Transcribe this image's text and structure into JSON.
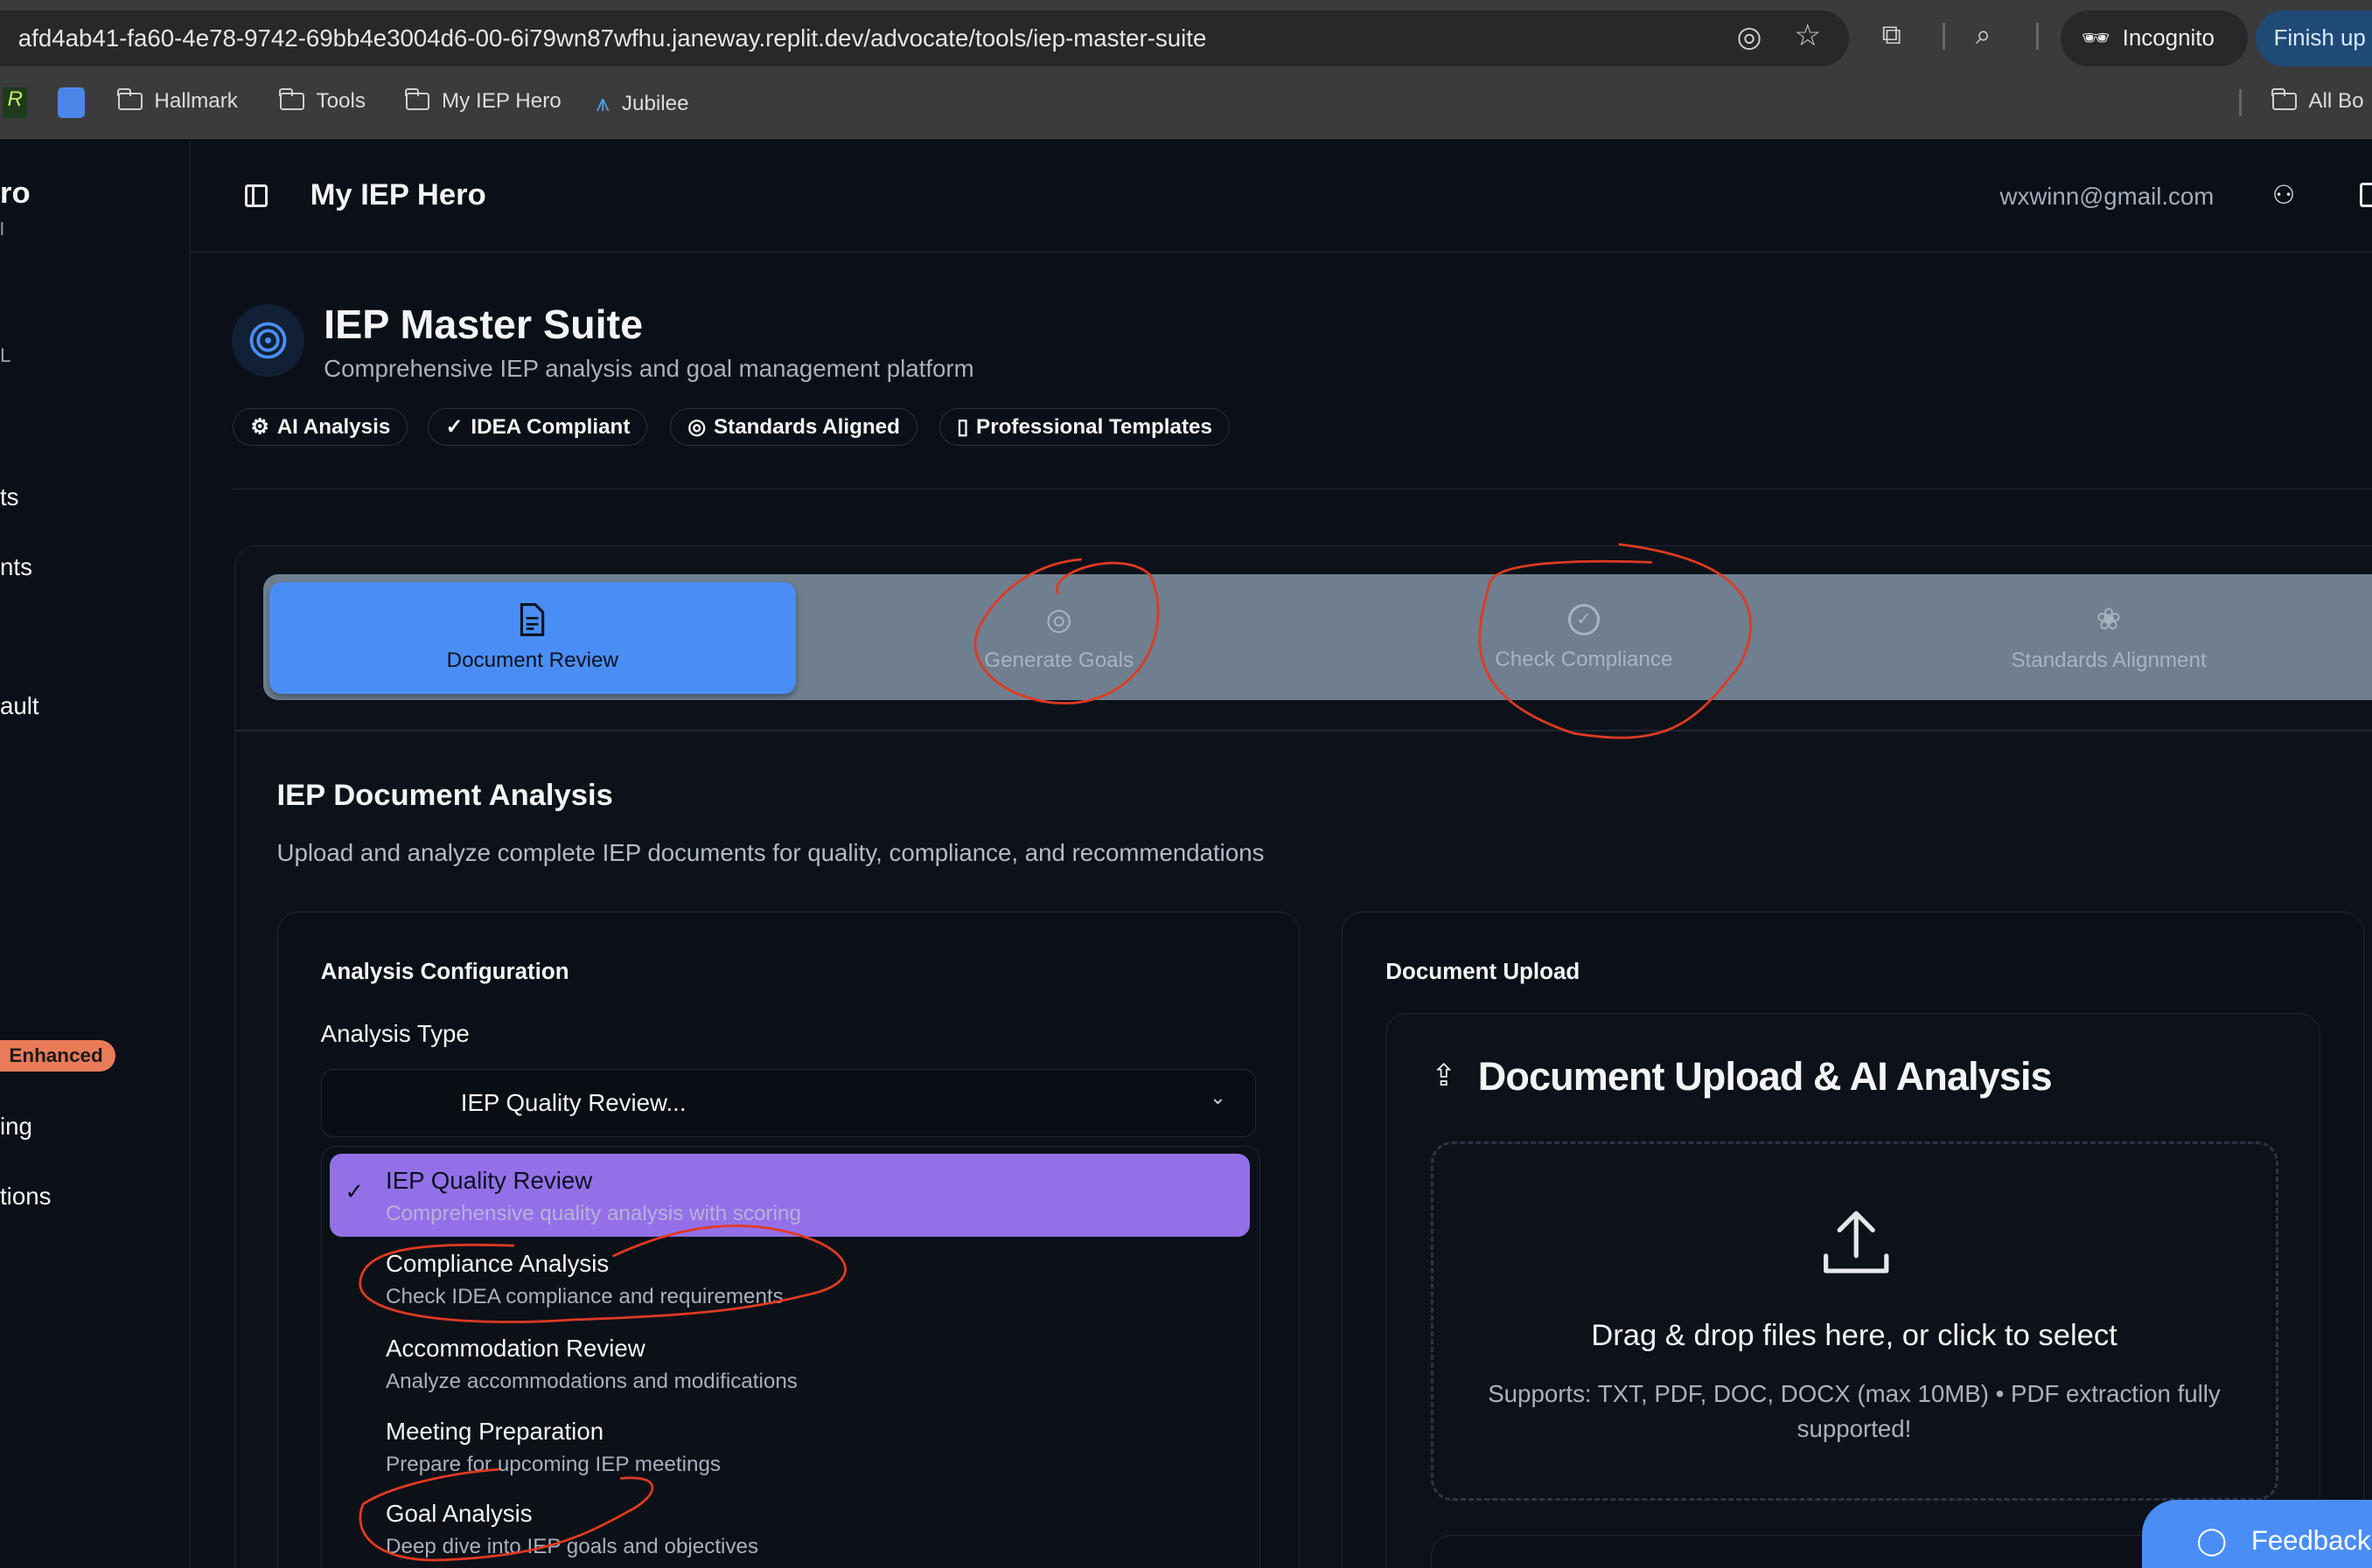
{
  "browser": {
    "url": "afd4ab41-fa60-4e78-9742-69bb4e3004d6-00-6i79wn87wfhu.janeway.replit.dev/advocate/tools/iep-master-suite",
    "incognito_label": "Incognito",
    "finish_update_label": "Finish up",
    "bookmarks": [
      "Hallmark",
      "Tools",
      "My IEP Hero",
      "Jubilee"
    ],
    "all_bookmarks_label": "All Bo"
  },
  "sidebar": {
    "brand_partial": "ro",
    "brand_sub_partial": "l",
    "items": [
      "L",
      "ts",
      "nts",
      "ault",
      "ing",
      "tions"
    ],
    "enhanced_badge": "Enhanced"
  },
  "header": {
    "title": "My IEP Hero",
    "email": "wxwinn@gmail.com"
  },
  "page": {
    "title": "IEP Master Suite",
    "subtitle": "Comprehensive IEP analysis and goal management platform",
    "badges": [
      "AI Analysis",
      "IDEA Compliant",
      "Standards Aligned",
      "Professional Templates"
    ]
  },
  "tabs": [
    {
      "label": "Document Review",
      "active": true
    },
    {
      "label": "Generate Goals",
      "active": false
    },
    {
      "label": "Check Compliance",
      "active": false
    },
    {
      "label": "Standards Alignment",
      "active": false
    }
  ],
  "section": {
    "title": "IEP Document Analysis",
    "description": "Upload and analyze complete IEP documents for quality, compliance, and recommendations"
  },
  "config": {
    "title": "Analysis Configuration",
    "type_label": "Analysis Type",
    "selected_value": "IEP Quality Review...",
    "options": [
      {
        "title": "IEP Quality Review",
        "desc": "Comprehensive quality analysis with scoring",
        "selected": true
      },
      {
        "title": "Compliance Analysis",
        "desc": "Check IDEA compliance and requirements"
      },
      {
        "title": "Accommodation Review",
        "desc": "Analyze accommodations and modifications"
      },
      {
        "title": "Meeting Preparation",
        "desc": "Prepare for upcoming IEP meetings"
      },
      {
        "title": "Goal Analysis",
        "desc": "Deep dive into IEP goals and objectives"
      }
    ]
  },
  "upload": {
    "card_title": "Document Upload",
    "heading": "Document Upload & AI Analysis",
    "drop_text": "Drag & drop files here, or click to select",
    "supports_text": "Supports: TXT, PDF, DOC, DOCX (max 10MB) • PDF extraction fully supported!"
  },
  "feedback_label": "Feedback",
  "colors": {
    "accent": "#4a8ef5",
    "selected_option": "#9370e8",
    "annotation": "#e03a22",
    "enhanced": "#e97b59"
  }
}
